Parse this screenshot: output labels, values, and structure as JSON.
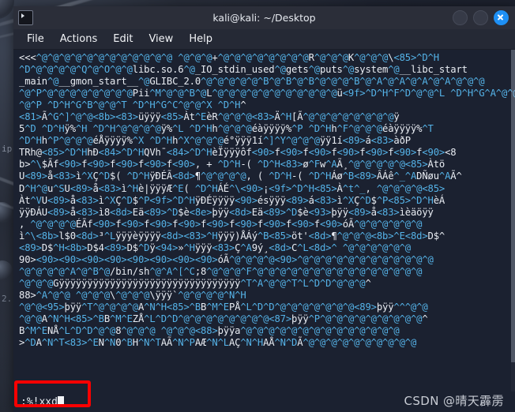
{
  "desktop": {
    "ip_label": "ip",
    "partial_number": "2."
  },
  "window": {
    "title": "kali@kali: ~/Desktop",
    "icon_name": "terminal-icon",
    "buttons": {
      "minimize_label": "",
      "maximize_label": "",
      "close_label": "×"
    }
  },
  "menubar": {
    "items": [
      {
        "label": "File"
      },
      {
        "label": "Actions"
      },
      {
        "label": "Edit"
      },
      {
        "label": "View"
      },
      {
        "label": "Help"
      }
    ]
  },
  "terminal": {
    "lines": [
      "<<<^@^@^@^@^@^@^@^@^@^@^@^@ ^@^@^@+^@^@^@^@^@^@^@^@R^@^@^@K^@^@^@\\<85>^D^H",
      "^D^@^@^@^@^Q^@^O^@^@libc.so.6^@_IO_stdin_used^@gets^@puts^@system^@__libc_start",
      "_main^@__gmon_start__^@GLIBC_2.0^@^@^@^@^@^B^@^B^@^B^@^@^@^B^@^A^@^A^@^A^@^A^@^@^@",
      "^@^P^@^@^@^@^@^@^@^@Pii^M^@^@^B^@L^@^@^@^@^@^@^@^@^@^@^@ü<9f>^D^H^F^D^@^@^L ^D^H^G^A^@^@^",
      "^@^P ^D^H^G^B^@^@^T ^D^H^G^C^@^@^X ^D^H^",
      "<81>Ã^G^]^@^@<8b><83>üÿÿÿ<85>Àt^EèR^@^@^@<83>Ä^H[Ã^@^@^@^@^@^@^@^@ÿ",
      "5^D ^D^Hÿ%^H ^D^H^@^@^@^@ÿ%^L ^D^Hh^@^@^@éàÿÿÿÿ%^P ^D^Hh^F^@^@^@éàÿÿÿÿ%^T",
      "^D^Hh^P^@^@^@éÅÿÿÿÿ%^X ^D^Hh^X^@^@^@é°ÿÿÿ1í^]^Y^@^@^@ÿÿ1í<89>á<83>àðP",
      "TRh@<85>^D^HhÐ<84>^D^HQVh¯<84>^D^HèÏÿÿÿôf<90>f<90>f<90>f<90>f<90>f<90>f<90><8",
      "b>^\\$Ãf<90>f<90>f<90>f<90>f<90>, + ^D^H-( ^D^H<83>ø^Fw^AÃ¸^@^@^@^@^@<85>Àtö",
      "U<89>å<83>ì^XÇ^D$( ^D^HÿÐÉÃ<8d>¶^@^@^@^@, ( ^D^H-( ^D^HÁø^B<89>ÂÁê^_^ADÑøu^AÃ^",
      "D^H^@u^SU<89>å<83>ì^Hè|ÿÿÿÆ^E( ^D^HÁÉ^\\<90>¡<9f>^D^H<85>À^t^_, ^@^@^@^@<85>",
      "Àt^VU<89>å<83>ì^XÇ^D$^P<9f>^D^HÿÐÉÿÿÿÿ<90>ésÿÿÿ<89>á<83>ì^XÇ^D$^P<85>^D^HèÁ",
      "ÿÿÐÁU<89>å<83>ì8<8d>Eä<89>^D$è<8e>þÿÿ<8d>Eä<89>^D$è<93>þÿÿ<89>å<83>ìèäöÿÿ",
      ", ^@^@^@^@ÉÃf<90>f<90>f<90>f<90>f<90>f<90>f<90>f<90>f<90>óÃ^@^@^@^@^@^@",
      "ì^\\<8b>l$0<8d>³^Lÿÿÿèÿÿÿÿ<8d><83>^Hÿÿÿ)ÅÁý^B<85>öt'<8d>¶^@^@^@<8b>^E<8d>D$^",
      "<89>D$^H<8b>D$4<89>D$^Dÿ<94>»^Hÿÿÿ<83>Ç^A9ý¸<8d>C^L<8d>^ ^@^@^@^@^@^@",
      "90><90><90><90><90><90><90><90><90>óÃ^@^@^@^@<90>^@^@^@^@^@^@^@^@^@^@^@^@",
      "^@^@^@^@^A^@^B^@/bin/sh^@^A^[^C;8^@^@^@^F^@^@^@^@^@^@^@^@^@^@^@^@^@^@^@",
      "^@^@^@Gÿÿÿÿÿÿÿÿÿÿÿÿÿÿÿÿÿÿÿÿÿÿÿÿÿÿÿÿÿÿÿÿ^T^A^@^@^T^L^D^D^@^@^@^",
      "88>^A^@^@ ^@^@^@\\^@^@^@\\ÿÿÿ`^@^@^@^@^N^H",
      "^@^@<95>þÿÿ^T^@^@^@^@A^N^H<85>^BB^M^EPÅ^L^D^D^@^@^@^@^@^@^@<89>þÿÿ^^^@^@",
      "^@^@A^N^H<85>^BB^M^EZÅ^L^D^D^@^@^@^@^@^@^@^@<87>þÿÿ^P^@^@^@^@^@^@^@^@^@^",
      "B^M^ENÅ^L^D^D^@^@8^@^@^@ ^@^@^@<88>þÿÿa^@^@^@^@^@^@^@^@^@^@^@^@^@^@",
      ">^DA^N^T<83>^EN^N0^BH^N^TAÃ^N^PAÆ^N^LAÇ^N^HAÅ^N^DÃ^@^@^@^@^@^@^@^@^@^@"
    ],
    "command_prompt": ":%!xxd",
    "cursor": " "
  },
  "annotation": {
    "color": "#f90000",
    "target": ":%!xxd"
  },
  "watermark": {
    "text": "CSDN @晴天霹雳"
  },
  "colors": {
    "terminal_bg": "#1b2130",
    "terminal_fg": "#e9edf3",
    "control_char": "#55b3e8",
    "titlebar_bg": "#2b2e39",
    "menubar_bg": "#252935",
    "close_btn": "#1e90f5",
    "annotation": "#f90000"
  }
}
